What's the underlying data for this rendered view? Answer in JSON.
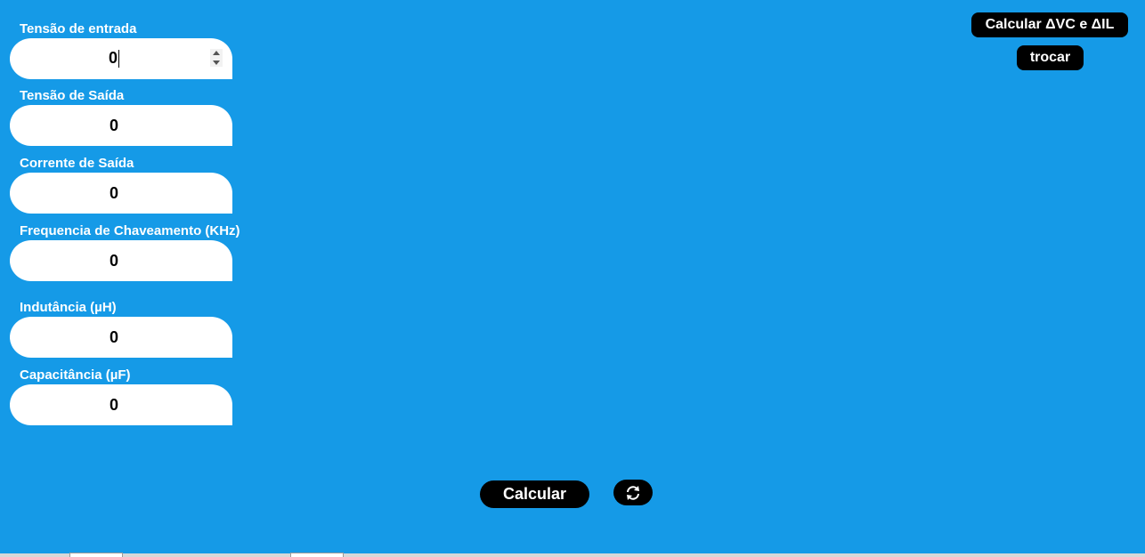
{
  "fields": [
    {
      "label": "Tensão de entrada",
      "value": "0"
    },
    {
      "label": "Tensão de Saída",
      "value": "0"
    },
    {
      "label": "Corrente de Saída",
      "value": "0"
    },
    {
      "label": "Frequencia de Chaveamento (KHz)",
      "value": "0"
    },
    {
      "label": "Indutância (µH)",
      "value": "0"
    },
    {
      "label": "Capacitância (µF)",
      "value": "0"
    }
  ],
  "buttons": {
    "calc_delta": "Calcular ΔVC e ΔIL",
    "trocar": "trocar",
    "calcular": "Calcular"
  },
  "icons": {
    "refresh": "refresh-icon",
    "spinner_up": "chevron-up-icon",
    "spinner_down": "chevron-down-icon"
  },
  "colors": {
    "background": "#159ae7",
    "button": "#000000",
    "input": "#ffffff"
  }
}
